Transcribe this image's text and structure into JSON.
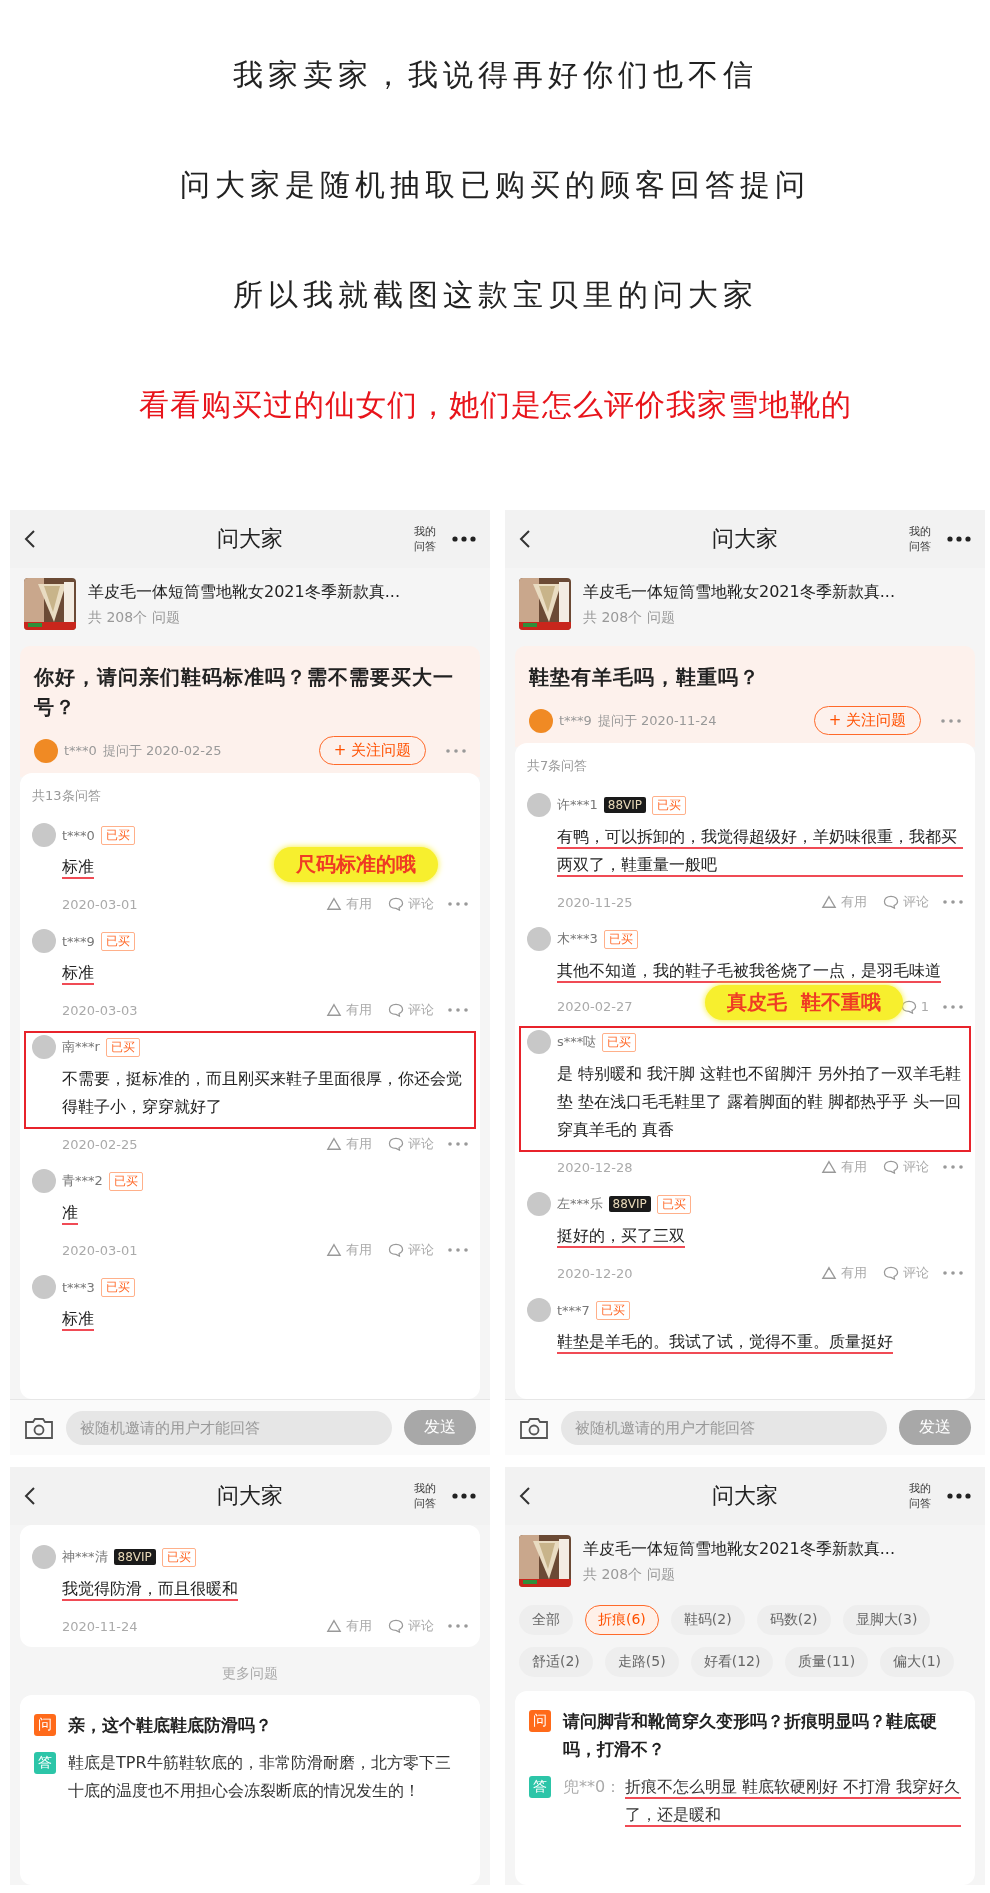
{
  "intro": [
    {
      "kind": "plain",
      "text": "我家卖家，我说得再好你们也不信"
    },
    {
      "kind": "plain",
      "text": "问大家是随机抽取已购买的顾客回答提问"
    },
    {
      "kind": "plain",
      "text": "所以我就截图这款宝贝里的问大家"
    },
    {
      "kind": "emphasis",
      "text": "看看购买过的仙女们，她们是怎么评价我家雪地靴的"
    }
  ],
  "panels": [
    {
      "title": "问大家",
      "my_qa": "我的问答",
      "product": {
        "name": "羊皮毛一体短筒雪地靴女2021冬季新款真...",
        "count": "共 208个 问题"
      },
      "question": {
        "text": "你好，请问亲们鞋码标准吗？需不需要买大一号？",
        "asker": "t***0",
        "asked": "提问于 2020-02-25",
        "follow": "+ 关注问题"
      },
      "answers_count": "共13条问答",
      "answers": [
        {
          "user": "t***0",
          "bought": "已买",
          "text": "标准",
          "underlined": true,
          "highlighted": false,
          "date": "2020-03-01",
          "useful": "有用",
          "comment": "评论",
          "sticker": {
            "kind": "text",
            "text": "尺码标准的哦"
          }
        },
        {
          "user": "t***9",
          "bought": "已买",
          "text": "标准",
          "underlined": true,
          "highlighted": false,
          "date": "2020-03-03",
          "useful": "有用",
          "comment": "评论"
        },
        {
          "user": "南***r",
          "bought": "已买",
          "text": "不需要，挺标准的，而且刚买来鞋子里面很厚，你还会觉得鞋子小，穿穿就好了",
          "underlined": false,
          "highlighted": true,
          "date": "2020-02-25",
          "useful": "有用",
          "comment": "评论"
        },
        {
          "user": "青***2",
          "bought": "已买",
          "text": "准",
          "underlined": true,
          "highlighted": false,
          "date": "2020-03-01",
          "useful": "有用",
          "comment": "评论"
        },
        {
          "user": "t***3",
          "bought": "已买",
          "text": "标准",
          "underlined": true,
          "highlighted": false
        }
      ],
      "input": {
        "placeholder": "被随机邀请的用户才能回答",
        "send": "发送"
      }
    },
    {
      "title": "问大家",
      "my_qa": "我的问答",
      "product": {
        "name": "羊皮毛一体短筒雪地靴女2021冬季新款真...",
        "count": "共 208个 问题"
      },
      "question": {
        "text": "鞋垫有羊毛吗，鞋重吗？",
        "asker": "t***9",
        "asked": "提问于 2020-11-24",
        "follow": "+ 关注问题"
      },
      "answers_count": "共7条问答",
      "answers": [
        {
          "user": "许***1",
          "vip": "88VIP",
          "bought": "已买",
          "text": "有鸭，可以拆卸的，我觉得超级好，羊奶味很重，我都买两双了，鞋重量一般吧",
          "underlined": true,
          "highlighted": false,
          "date": "2020-11-25",
          "useful": "有用",
          "comment": "评论"
        },
        {
          "user": "木***3",
          "bought": "已买",
          "text": "其他不知道，我的鞋子毛被我爸烧了一点，是羽毛味道",
          "underlined": true,
          "highlighted": false,
          "date": "2020-02-27",
          "comment": "1",
          "sticker": {
            "kind": "meta",
            "text": "真皮毛  鞋不重哦"
          }
        },
        {
          "user": "s***哒",
          "bought": "已买",
          "text": "是 特别暖和 我汗脚 这鞋也不留脚汗  另外拍了一双羊毛鞋垫 垫在浅口毛毛鞋里了 露着脚面的鞋 脚都热乎乎 头一回穿真羊毛的 真香",
          "underlined": false,
          "highlighted": true,
          "date": "2020-12-28",
          "useful": "有用",
          "comment": "评论"
        },
        {
          "user": "左***乐",
          "vip": "88VIP",
          "bought": "已买",
          "text": "挺好的，买了三双",
          "underlined": true,
          "highlighted": false,
          "date": "2020-12-20",
          "useful": "有用",
          "comment": "评论"
        },
        {
          "user": "t***7",
          "bought": "已买",
          "text": "鞋垫是羊毛的。我试了试，觉得不重。质量挺好",
          "underlined": true,
          "highlighted": false
        }
      ],
      "input": {
        "placeholder": "被随机邀请的用户才能回答",
        "send": "发送"
      }
    },
    {
      "title": "问大家",
      "my_qa": "我的问答",
      "answers": [
        {
          "user": "神***清",
          "vip": "88VIP",
          "bought": "已买",
          "text": "我觉得防滑，而且很暖和",
          "underlined": true,
          "highlighted": false,
          "date": "2020-11-24",
          "useful": "有用",
          "comment": "评论"
        }
      ],
      "more_label": "更多问题",
      "qa": {
        "q_badge": "问",
        "question": "亲，这个鞋底鞋底防滑吗？",
        "a_badge": "答",
        "answer": "鞋底是TPR牛筋鞋软底的，非常防滑耐磨，北方零下三十底的温度也不用担心会冻裂断底的情况发生的！",
        "underlined": false
      }
    },
    {
      "title": "问大家",
      "my_qa": "我的问答",
      "product": {
        "name": "羊皮毛一体短筒雪地靴女2021冬季新款真...",
        "count": "共 208个 问题"
      },
      "tags": [
        {
          "label": "全部",
          "selected": false
        },
        {
          "label": "折痕(6)",
          "selected": true
        },
        {
          "label": "鞋码(2)",
          "selected": false
        },
        {
          "label": "码数(2)",
          "selected": false
        },
        {
          "label": "显脚大(3)",
          "selected": false
        },
        {
          "label": "舒适(2)",
          "selected": false
        },
        {
          "label": "走路(5)",
          "selected": false
        },
        {
          "label": "好看(12)",
          "selected": false
        },
        {
          "label": "质量(11)",
          "selected": false
        },
        {
          "label": "偏大(1)",
          "selected": false
        }
      ],
      "qa": {
        "q_badge": "问",
        "question": "请问脚背和靴筒穿久变形吗？折痕明显吗？鞋底硬吗，打滑不？",
        "a_badge": "答",
        "answerer": "兜**0：",
        "answer": "折痕不怎么明显 鞋底软硬刚好 不打滑 我穿好久了，还是暖和",
        "underlined": true
      }
    }
  ]
}
